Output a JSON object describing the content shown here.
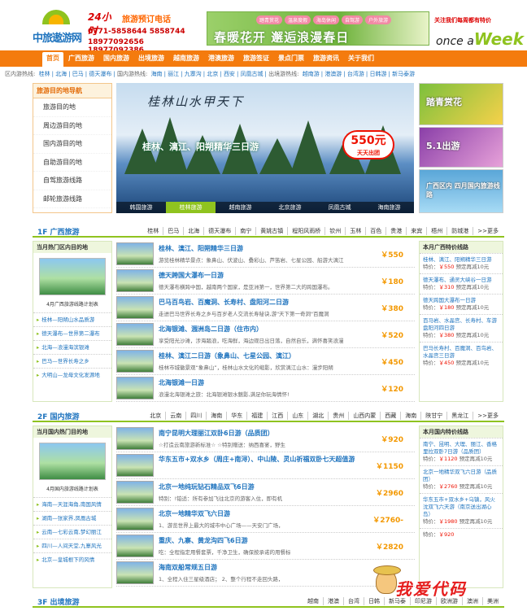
{
  "header": {
    "logo_text": "中旅遨游网",
    "hotline_24": "24小时",
    "hotline_title": "旅游预订电话",
    "hotline_1": "0771-5858644 5858744",
    "hotline_2": "18977092656 18977092386",
    "banner_tags": [
      "踏青赏花",
      "温泉度假",
      "海岛休闲",
      "自驾游",
      "户外旅游"
    ],
    "banner_text": "春暖花开 邂逅浪漫春日",
    "weekly_tagline": "关注我们每周都有特价",
    "weekly_logo_a": "once a",
    "weekly_logo_b": "Week"
  },
  "nav": {
    "items": [
      "首页",
      "广西旅游",
      "国内旅游",
      "出境旅游",
      "越南旅游",
      "港澳旅游",
      "旅游签证",
      "景点门票",
      "旅游资讯",
      "关于我们"
    ]
  },
  "subnav": {
    "label1": "区内游热线:",
    "links1": [
      "桂林",
      "北海",
      "巴马",
      "德天瀑布"
    ],
    "label2": "国内游热线:",
    "links2": [
      "海南",
      "丽江",
      "九寨沟",
      "北京",
      "西安",
      "凤凰古城"
    ],
    "label3": "出境游热线:",
    "links3": [
      "越南游",
      "港澳游",
      "台湾游",
      "日韩游",
      "新马泰游"
    ]
  },
  "leftmenu": {
    "title": "旅游目的地导航",
    "items": [
      "旅游目的地",
      "周边游目的地",
      "国内游目的地",
      "自助游目的地",
      "自驾旅游线路",
      "邮轮旅游线路"
    ]
  },
  "slide": {
    "title": "桂林山水甲天下",
    "main": "桂林、漓江、阳朔精华三日游",
    "price": "550元",
    "price_sub": "天天出团",
    "tabs": [
      "韩国旅游",
      "桂林旅游",
      "越南旅游",
      "北京旅游",
      "凤凰古城",
      "海南旅游"
    ]
  },
  "promos": [
    "踏青赏花",
    "5.1出游",
    "广西区内 四月国内旅游线路"
  ],
  "sec1": {
    "title": "1F 广西旅游",
    "links": [
      "桂林",
      "巴马",
      "北海",
      "德天瀑布",
      "南宁",
      "黄姚古镇",
      "程阳风雨桥",
      "钦州",
      "玉林",
      "百色",
      "贵港",
      "来宾",
      "梧州",
      "防城港",
      ">>更多"
    ],
    "side_title": "当月热门区内目的地",
    "side_caption": "4月广西旅游线路计划表",
    "side_items": [
      "桂林—阳朔山水品质游",
      "德天瀑布—世界第二瀑布",
      "北海—浪漫海滨银滩",
      "巴马—世界长寿之乡",
      "大明山—龙母文化发源地"
    ],
    "rows": [
      {
        "title": "桂林、漓江、阳朔精华三日游",
        "desc": "游览桂林精华景点：象鼻山、伏波山、叠彩山、芦笛岩、七星公园、船游大漓江",
        "price": "￥550"
      },
      {
        "title": "德天跨国大瀑布一日游",
        "desc": "德天瀑布横跨中国，越南两个国家，是亚洲第一，世界第二大的跨国瀑布。",
        "price": "￥180"
      },
      {
        "title": "巴马百鸟岩、百魔洞、长寿村、盘阳河二日游",
        "desc": "走进巴马世界长寿之乡与百岁老人交流长寿秘诀,游\"天下第一奇洞\"百魔洞",
        "price": "￥380"
      },
      {
        "title": "北海银滩、涠洲岛二日游（住市内）",
        "desc": "享受阳光沙滩，涉海踏浪，吃海鲜，海边观日出日落，自然自乐，满怀喜笑浪漫",
        "price": "￥520"
      },
      {
        "title": "桂林、漓江二日游（象鼻山、七星公园、漓江）",
        "desc": "桂林市城徽景观“象鼻山”，桂林山水文化的缩影，欣赏漓江山水：漫步阳朔",
        "price": "￥450"
      },
      {
        "title": "北海银滩一日游",
        "desc": "浪漫北海银滩之旅：北海银滩银水魅影,满足你玩海情怀!",
        "price": "￥120"
      }
    ],
    "price_title": "本月广西特价线路",
    "prices": [
      {
        "name": "桂林、漓江、阳朔精华三日游",
        "label": "特价：",
        "price": "￥550",
        "note": "预定再减10元"
      },
      {
        "name": "德天瀑布、通灵大峡谷一日游",
        "label": "特价：",
        "price": "￥310",
        "note": "预定再减10元"
      },
      {
        "name": "德天跨国大瀑布一日游",
        "label": "特价：",
        "price": "￥180",
        "note": "预定再减10元"
      },
      {
        "name": "百马岩、水晶宫、长寿村、车游盘阳河四日游",
        "label": "特价：",
        "price": "￥380",
        "note": "预定再减10元"
      },
      {
        "name": "巴马长寿村、百魔洞、百鸟岩、水晶宫三日游",
        "label": "特价：",
        "price": "￥450",
        "note": "预定再减10元"
      }
    ]
  },
  "sec2": {
    "title": "2F 国内旅游",
    "links": [
      "北京",
      "云南",
      "四川",
      "海南",
      "华东",
      "福建",
      "江西",
      "山东",
      "湖北",
      "贵州",
      "山西内蒙",
      "西藏",
      "海南",
      "陕甘宁",
      "黑龙江",
      ">>更多"
    ],
    "side_title": "当月国内热门目的地",
    "side_caption": "4月国内旅游线路计划表",
    "side_items": [
      "海南—天涯海角,南国风情",
      "湖南—张家界,凤凰古城",
      "云南—七彩云南,梦幻丽江",
      "四川—人间天堂,九寨风光",
      "北京—皇城根下的风情"
    ],
    "rows": [
      {
        "title": "南宁昆明大理丽江双卧6日游（品质团）",
        "desc": "☆打造云南旅游新标准☆ ☆特别赠送：纳西喜宴，野生",
        "price": "￥920"
      },
      {
        "title": "华东五市+双水乡（周庄+南浔）、中山陵、灵山祈福双卧七天超值游",
        "desc": "",
        "price": "￥1150"
      },
      {
        "title": "北京一地纯玩钻石精品双飞6日游",
        "desc": "特别：!铂适：所有参加飞往北京的游客入住，即有机",
        "price": "￥2960"
      },
      {
        "title": "北京一地精华双飞六日游",
        "desc": "1、游览世界上最大的城市中心广场——天安门广场，",
        "price": "￥2760-"
      },
      {
        "title": "重庆、九寨、黄龙沟四飞6日游",
        "desc": "吃：全程指定用餐套票，千净卫生，确保按承诺的用餐标",
        "price": "￥2820"
      },
      {
        "title": "海南双船常规五日游",
        "desc": "1、全程入住三星级酒店； 2、整个行程不走回头路，",
        "price": ""
      }
    ],
    "price_title": "本月国内特价线路",
    "prices": [
      {
        "name": "南宁、昆明、大理、丽江、香格里拉双卧7日游（品质团）",
        "label": "特价：",
        "price": "￥1120",
        "note": "预定再减10元"
      },
      {
        "name": "北京一地精华双飞六日游（品质团）",
        "label": "特价：",
        "price": "￥2760",
        "note": "预定再减10元"
      },
      {
        "name": "华东五市+双水乡+乌镇，风火沈双飞六天游（南京送出湖心岛）",
        "label": "特价：",
        "price": "￥1980",
        "note": "预定再减10元"
      },
      {
        "name": "",
        "label": "特价：",
        "price": "￥920",
        "note": ""
      }
    ]
  },
  "sec3": {
    "title": "3F 出境旅游",
    "links": [
      "越南",
      "港澳",
      "台湾",
      "日韩",
      "新马泰",
      "印尼游",
      "欧洲游",
      "澳洲",
      "美洲"
    ]
  },
  "watermark": "我爱代码"
}
